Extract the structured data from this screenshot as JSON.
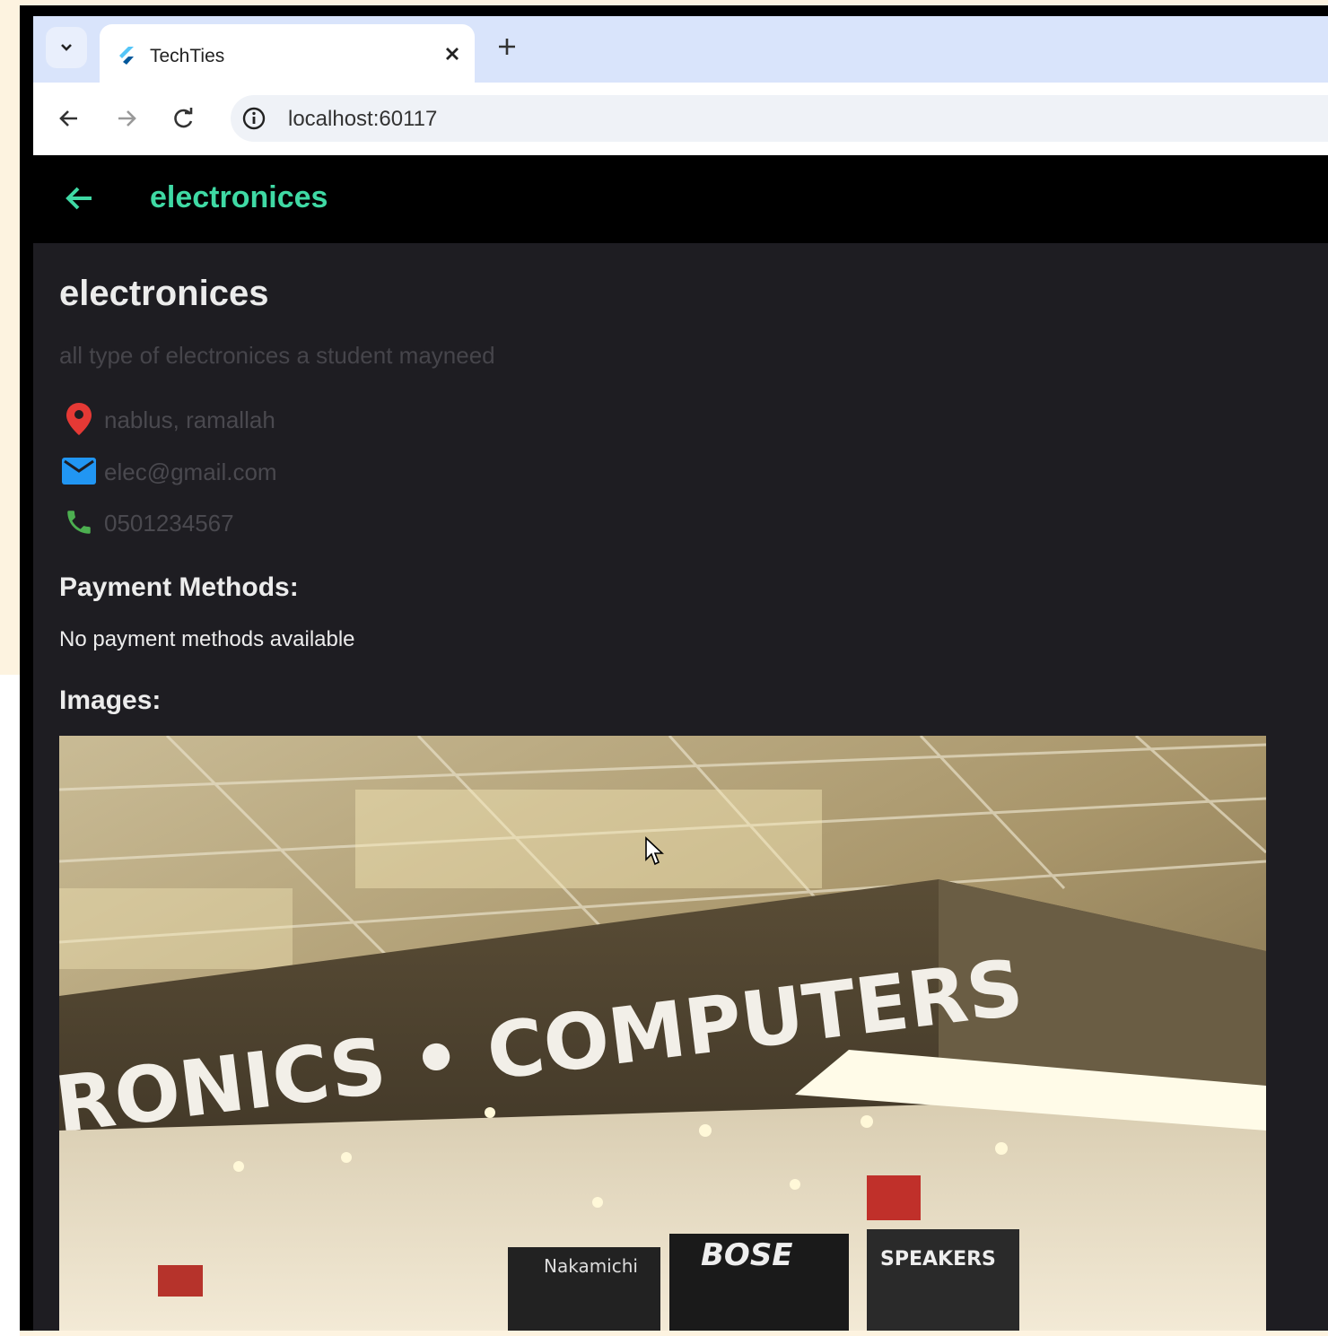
{
  "browser": {
    "tab_title": "TechTies",
    "url": "localhost:60117"
  },
  "appbar": {
    "title": "electronices"
  },
  "store": {
    "name": "electronices",
    "description": "all type of electronices a student mayneed",
    "location": "nablus, ramallah",
    "email": "elec@gmail.com",
    "phone": "0501234567"
  },
  "payment": {
    "heading": "Payment Methods:",
    "empty_text": "No payment methods available"
  },
  "images": {
    "heading": "Images:",
    "sign_text": "RONICS • COMPUTERS",
    "booth_labels": [
      "Nakamichi",
      "BOSE",
      "SPEAKERS"
    ]
  },
  "colors": {
    "accent": "#3fd9a4",
    "location_icon": "#e53935",
    "email_icon": "#2196f3",
    "phone_icon": "#4caf50"
  },
  "icons": [
    "chevron-down-icon",
    "flutter-icon",
    "close-icon",
    "plus-icon",
    "arrow-back-icon",
    "arrow-forward-icon",
    "reload-icon",
    "info-icon",
    "location-pin-icon",
    "email-icon",
    "phone-icon",
    "mouse-cursor-icon"
  ]
}
